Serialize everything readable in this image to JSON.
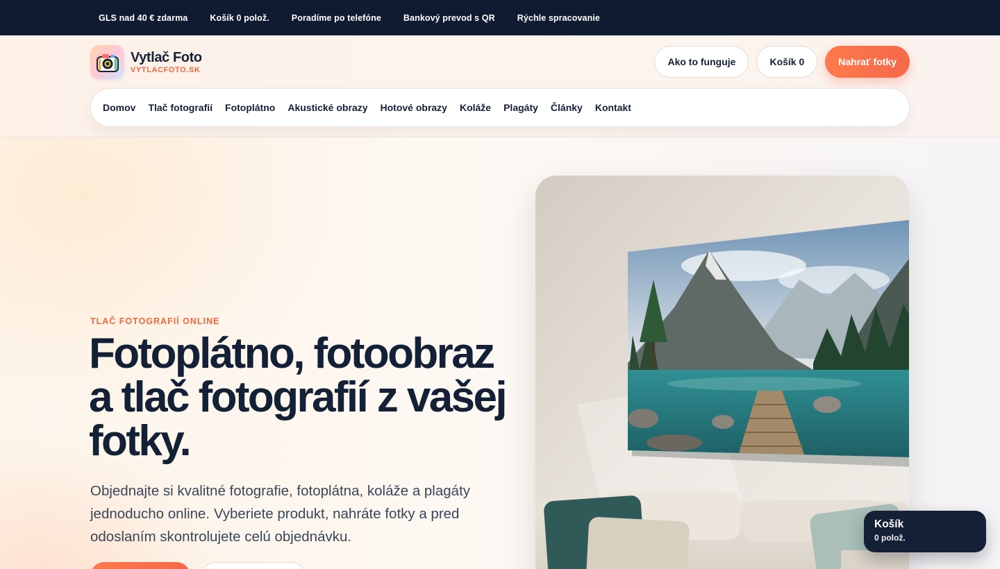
{
  "topbar": {
    "items": [
      "GLS nad 40 € zdarma",
      "Košík 0 polož.",
      "Poradíme po telefóne",
      "Bankový prevod s QR",
      "Rýchle spracovanie"
    ]
  },
  "brand": {
    "name": "Vytlač Foto",
    "domain": "VYTLACFOTO.SK",
    "logo_icon": "camera-icon"
  },
  "header_actions": {
    "how_it_works": "Ako to funguje",
    "cart": "Košík 0",
    "upload": "Nahrať fotky"
  },
  "nav": {
    "items": [
      "Domov",
      "Tlač fotografií",
      "Fotoplátno",
      "Akustické obrazy",
      "Hotové obrazy",
      "Koláže",
      "Plagáty",
      "Články",
      "Kontakt"
    ]
  },
  "hero": {
    "eyebrow": "TLAČ FOTOGRAFIÍ ONLINE",
    "headline_lines": [
      "Fotoplátno, fotoobraz",
      "a tlač fotografií z vašej",
      "fotky."
    ],
    "subtext": "Objednajte si kvalitné fotografie, fotoplátna, koláže a plagáty jednoducho online. Vyberiete produkt, nahráte fotky a pred odoslaním skontrolujete celú objednávku.",
    "image_alt_icon": "canvas-photo-image"
  },
  "floating_cart": {
    "title": "Košík",
    "count": "0 polož."
  },
  "colors": {
    "dark": "#142036",
    "topbar": "#0e1b30",
    "accent": "#f4694a"
  }
}
